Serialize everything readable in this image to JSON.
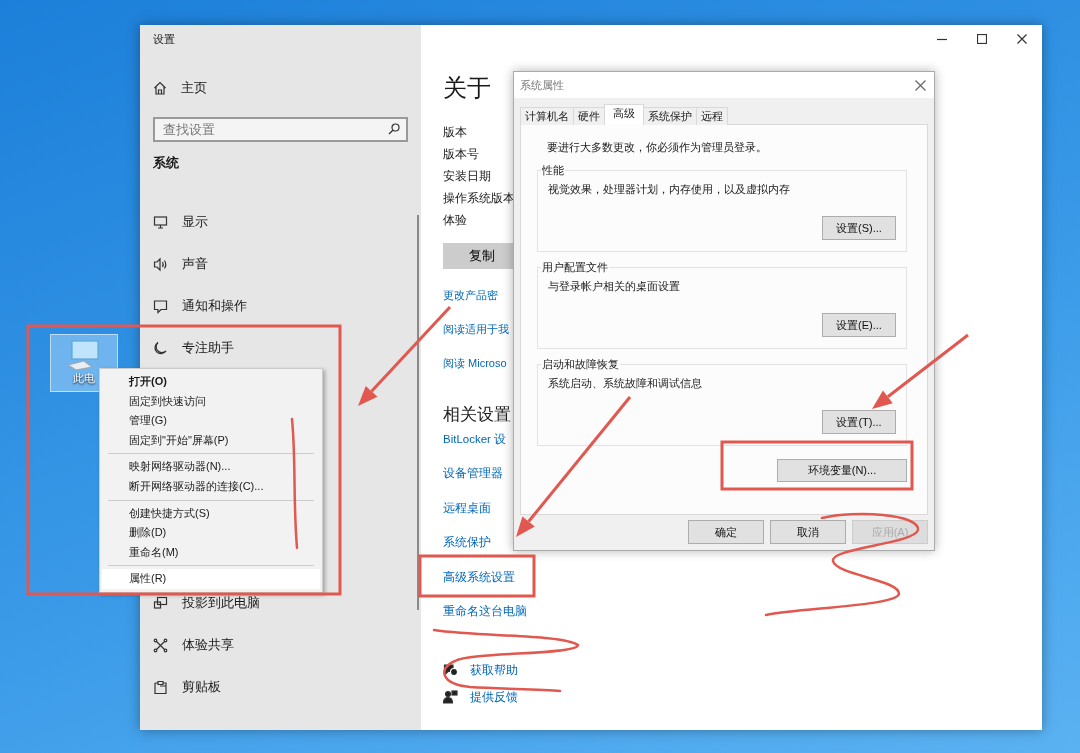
{
  "desktop": {
    "icons": [
      {
        "label": "此电",
        "selected": true
      }
    ]
  },
  "settings_window": {
    "title": "设置",
    "sidebar": {
      "home": "主页",
      "search": {
        "placeholder": "查找设置"
      },
      "section": "系统",
      "items": [
        {
          "label": "显示"
        },
        {
          "label": "声音"
        },
        {
          "label": "通知和操作"
        },
        {
          "label": "专注助手"
        }
      ],
      "items_lower": [
        {
          "label": "投影到此电脑"
        },
        {
          "label": "体验共享"
        },
        {
          "label": "剪贴板"
        }
      ]
    },
    "content": {
      "heading": "关于",
      "spec_labels": [
        "版本",
        "版本号",
        "安装日期",
        "操作系统版本",
        "体验"
      ],
      "copy_button": "复制",
      "links": [
        "更改产品密",
        "阅读适用于我",
        "阅读 Microso"
      ],
      "related_heading": "相关设置",
      "related_links": [
        "BitLocker 设",
        "设备管理器",
        "远程桌面",
        "系统保护",
        "高级系统设置",
        "重命名这台电脑"
      ],
      "help_links": [
        "获取帮助",
        "提供反馈"
      ]
    }
  },
  "context_menu": {
    "groups": [
      [
        {
          "label": "打开(O)",
          "default": true,
          "selected": false
        },
        {
          "label": "固定到快速访问",
          "default": false,
          "selected": false
        },
        {
          "label": "管理(G)",
          "default": false,
          "selected": false
        },
        {
          "label": "固定到\"开始\"屏幕(P)",
          "default": false,
          "selected": false
        }
      ],
      [
        {
          "label": "映射网络驱动器(N)...",
          "default": false,
          "selected": false
        },
        {
          "label": "断开网络驱动器的连接(C)...",
          "default": false,
          "selected": false
        }
      ],
      [
        {
          "label": "创建快捷方式(S)",
          "default": false,
          "selected": false
        },
        {
          "label": "删除(D)",
          "default": false,
          "selected": false
        },
        {
          "label": "重命名(M)",
          "default": false,
          "selected": false
        }
      ],
      [
        {
          "label": "属性(R)",
          "default": false,
          "selected": true
        }
      ]
    ]
  },
  "dialog": {
    "title": "系统属性",
    "tabs": [
      {
        "label": "计算机名",
        "selected": false
      },
      {
        "label": "硬件",
        "selected": false
      },
      {
        "label": "高级",
        "selected": true
      },
      {
        "label": "系统保护",
        "selected": false
      },
      {
        "label": "远程",
        "selected": false
      }
    ],
    "notice": "要进行大多数更改，你必须作为管理员登录。",
    "groups": [
      {
        "title": "性能",
        "description": "视觉效果，处理器计划，内存使用，以及虚拟内存",
        "button": "设置(S)..."
      },
      {
        "title": "用户配置文件",
        "description": "与登录帐户相关的桌面设置",
        "button": "设置(E)..."
      },
      {
        "title": "启动和故障恢复",
        "description": "系统启动、系统故障和调试信息",
        "button": "设置(T)..."
      }
    ],
    "env_button": "环境变量(N)...",
    "footer_buttons": [
      {
        "label": "确定",
        "disabled": false
      },
      {
        "label": "取消",
        "disabled": false
      },
      {
        "label": "应用(A)",
        "disabled": true
      }
    ]
  }
}
